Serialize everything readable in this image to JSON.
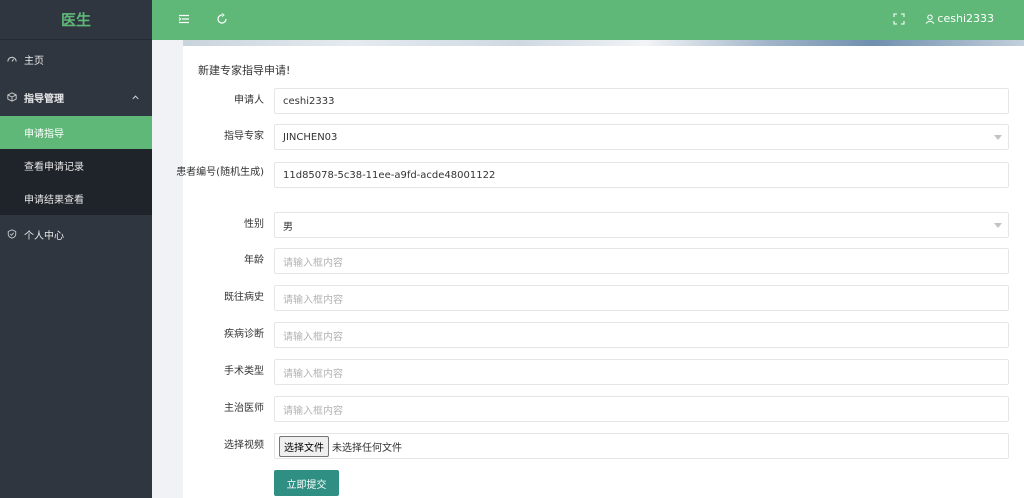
{
  "app": {
    "title": "医生"
  },
  "sidebar": {
    "home": "主页",
    "guide_manage": "指导管理",
    "sub": [
      "申请指导",
      "查看申请记录",
      "申请结果查看"
    ],
    "personal": "个人中心"
  },
  "header": {
    "username": "ceshi2333"
  },
  "form": {
    "title": "新建专家指导申请!",
    "applicant_label": "申请人",
    "applicant_value": "ceshi2333",
    "expert_label": "指导专家",
    "expert_value": "JINCHEN03",
    "patient_label": "患者编号(随机生成)",
    "patient_value": "11d85078-5c38-11ee-a9fd-acde48001122",
    "gender_label": "性别",
    "gender_value": "男",
    "age_label": "年龄",
    "history_label": "既往病史",
    "diagnosis_label": "疾病诊断",
    "surgery_label": "手术类型",
    "doctor_label": "主治医师",
    "placeholder": "请输入框内容",
    "video_label": "选择视频",
    "file_button": "选择文件",
    "file_status": "未选择任何文件",
    "submit": "立即提交"
  },
  "colors": {
    "accent": "#5fb878",
    "sidebar": "#2f3640",
    "submit": "#2f8f83"
  }
}
